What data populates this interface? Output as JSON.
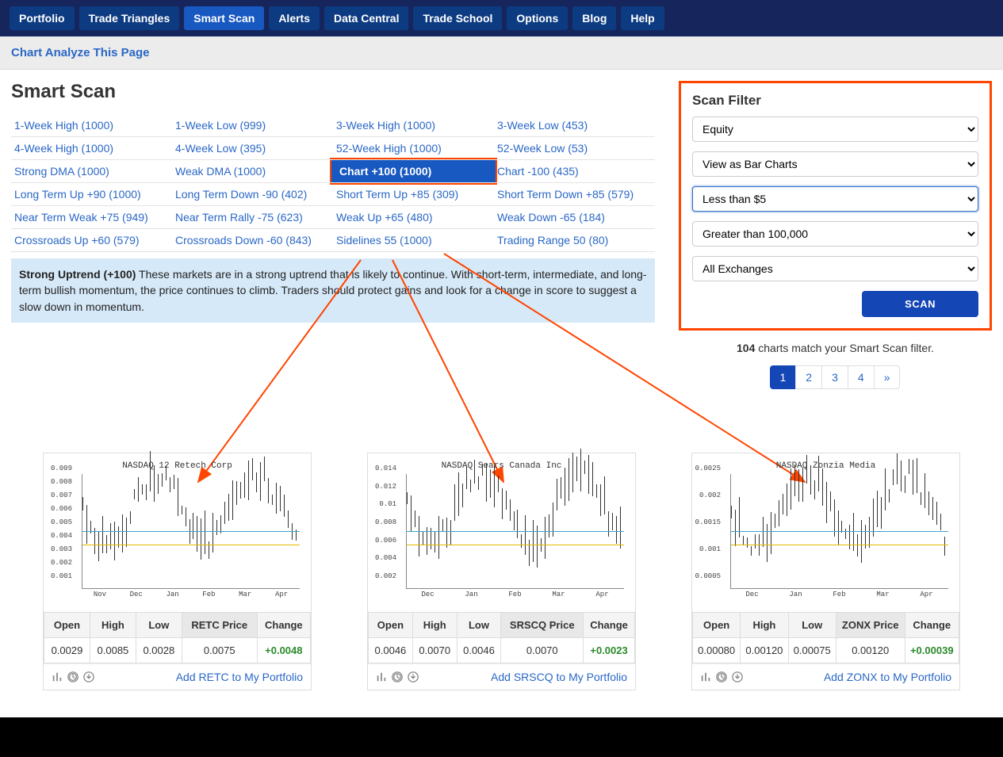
{
  "nav": [
    "Portfolio",
    "Trade Triangles",
    "Smart Scan",
    "Alerts",
    "Data Central",
    "Trade School",
    "Options",
    "Blog",
    "Help"
  ],
  "nav_active": 2,
  "subbar": {
    "link": "Chart Analyze This Page"
  },
  "page_title": "Smart Scan",
  "categories": [
    [
      "1-Week High (1000)",
      "1-Week Low (999)",
      "3-Week High (1000)",
      "3-Week Low (453)"
    ],
    [
      "4-Week High (1000)",
      "4-Week Low (395)",
      "52-Week High (1000)",
      "52-Week Low (53)"
    ],
    [
      "Strong DMA (1000)",
      "Weak DMA (1000)",
      "Chart +100 (1000)",
      "Chart -100 (435)"
    ],
    [
      "Long Term Up +90 (1000)",
      "Long Term Down -90 (402)",
      "Short Term Up +85 (309)",
      "Short Term Down +85 (579)"
    ],
    [
      "Near Term Weak +75 (949)",
      "Near Term Rally -75 (623)",
      "Weak Up +65 (480)",
      "Weak Down -65 (184)"
    ],
    [
      "Crossroads Up +60 (579)",
      "Crossroads Down -60 (843)",
      "Sidelines 55 (1000)",
      "Trading Range 50 (80)"
    ]
  ],
  "highlighted_cell": {
    "row": 2,
    "col": 2
  },
  "description": {
    "title": "Strong Uptrend (+100)",
    "body": "These markets are in a strong uptrend that is likely to continue. With short-term, intermediate, and long-term bullish momentum, the price continues to climb. Traders should protect gains and look for a change in score to suggest a slow down in momentum."
  },
  "scan_filter": {
    "heading": "Scan Filter",
    "selects": [
      {
        "value": "Equity",
        "hl": false
      },
      {
        "value": "View as Bar Charts",
        "hl": false
      },
      {
        "value": "Less than $5",
        "hl": true
      },
      {
        "value": "Greater than 100,000",
        "hl": false
      },
      {
        "value": "All Exchanges",
        "hl": false
      }
    ],
    "button": "SCAN"
  },
  "match": {
    "count": "104",
    "suffix": " charts match your Smart Scan filter."
  },
  "pager": [
    "1",
    "2",
    "3",
    "4",
    "»"
  ],
  "pager_active": 0,
  "table_headers": [
    "Open",
    "High",
    "Low"
  ],
  "charts": [
    {
      "title": "NASDAQ 12 Retech Corp",
      "yticks": [
        "0.009",
        "0.008",
        "0.007",
        "0.006",
        "0.005",
        "0.004",
        "0.003",
        "0.002",
        "0.001"
      ],
      "xticks": [
        "Nov",
        "Dec",
        "Jan",
        "Feb",
        "Mar",
        "Apr"
      ],
      "sym_header": "RETC Price",
      "open": "0.0029",
      "high": "0.0085",
      "low": "0.0028",
      "price": "0.0075",
      "change": "+0.0048",
      "add": "Add RETC to My Portfolio"
    },
    {
      "title": "NASDAQ Sears Canada Inc",
      "yticks": [
        "0.014",
        "0.012",
        "0.01",
        "0.008",
        "0.006",
        "0.004",
        "0.002"
      ],
      "xticks": [
        "Dec",
        "Jan",
        "Feb",
        "Mar",
        "Apr"
      ],
      "sym_header": "SRSCQ Price",
      "open": "0.0046",
      "high": "0.0070",
      "low": "0.0046",
      "price": "0.0070",
      "change": "+0.0023",
      "add": "Add SRSCQ to My Portfolio"
    },
    {
      "title": "NASDAQ Zonzia Media",
      "yticks": [
        "0.0025",
        "0.002",
        "0.0015",
        "0.001",
        "0.0005"
      ],
      "xticks": [
        "Dec",
        "Jan",
        "Feb",
        "Mar",
        "Apr"
      ],
      "sym_header": "ZONX Price",
      "open": "0.00080",
      "high": "0.00120",
      "low": "0.00075",
      "price": "0.00120",
      "change": "+0.00039",
      "add": "Add ZONX to My Portfolio"
    }
  ],
  "change_header": "Change"
}
